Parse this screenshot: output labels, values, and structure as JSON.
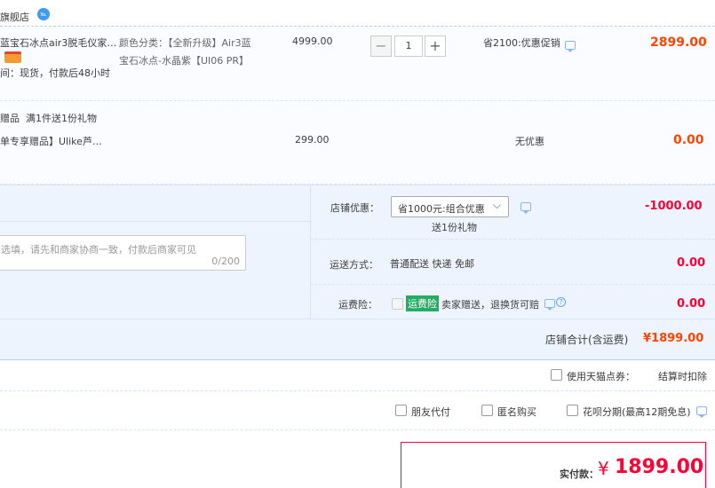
{
  "shop": {
    "name": "旗舰店",
    "badge": "℡"
  },
  "item1": {
    "title": "蓝宝石冰点air3脱毛仪家…",
    "shipping": "间：现货，付款后48小时",
    "sku_line1": "颜色分类：【全新升级】Air3蓝",
    "sku_line2": "宝石冰点-水晶紫【UI06 PR】",
    "unit_price": "4999.00",
    "quantity": "1",
    "minus": "−",
    "plus": "+",
    "discount": "省2100:优惠促销",
    "subtotal": "2899.00"
  },
  "gift": {
    "label": "赠品",
    "rule": "满1件送1份礼物",
    "title": "单专享赠品】Ulike芦…",
    "unit_price": "299.00",
    "discount": "无优惠",
    "subtotal": "0.00"
  },
  "order": {
    "message_placeholder": "选填，请先和商家协商一致，付款后商家可见",
    "message_counter": "0/200",
    "shop_discount_label": "店铺优惠：",
    "shop_discount_value": "省1000元:组合优惠",
    "shop_discount_gift": "送1份礼物",
    "shop_discount_amount": "-1000.00",
    "delivery_label": "运送方式：",
    "delivery_value": "普通配送 快递 免邮",
    "delivery_amount": "0.00",
    "insurance_label": "运费险：",
    "insurance_tag": "运费险",
    "insurance_desc": "卖家赠送，退换货可赔",
    "insurance_amount": "0.00",
    "shop_total_label": "店铺合计(含运费)",
    "shop_total_value": "¥1899.00"
  },
  "options": {
    "tmall_points": "使用天猫点券：",
    "settle_note": "结算时扣除",
    "friend_pay": "朋友代付",
    "anonymous": "匿名购买",
    "huabei": "花呗分期(最高12期免息)"
  },
  "payment": {
    "label": "实付款：",
    "currency": "¥",
    "amount": "1899.00"
  }
}
